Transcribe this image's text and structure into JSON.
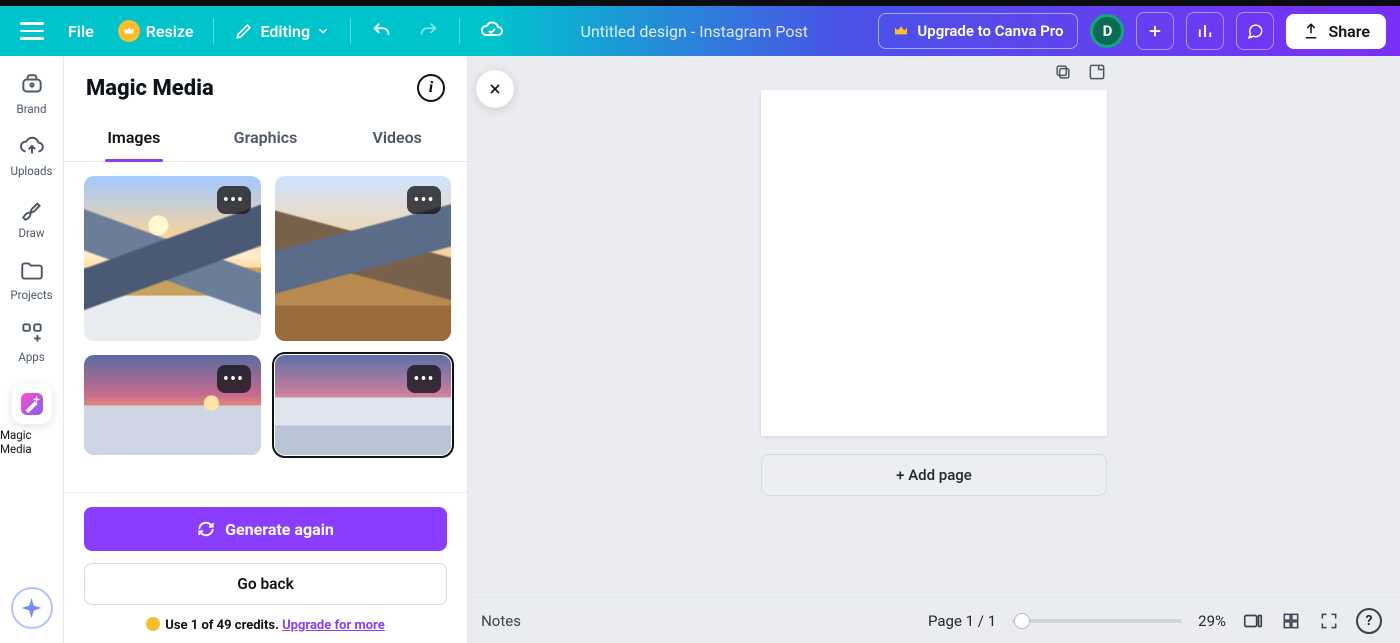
{
  "topbar": {
    "file": "File",
    "resize": "Resize",
    "editing": "Editing",
    "title": "Untitled design - Instagram Post",
    "upgrade": "Upgrade to Canva Pro",
    "avatar_initial": "D",
    "share": "Share"
  },
  "rail": {
    "brand": "Brand",
    "uploads": "Uploads",
    "draw": "Draw",
    "projects": "Projects",
    "apps": "Apps",
    "magic_media": "Magic Media"
  },
  "panel": {
    "title": "Magic Media",
    "tabs": {
      "images": "Images",
      "graphics": "Graphics",
      "videos": "Videos"
    },
    "generate": "Generate again",
    "go_back": "Go back",
    "credits_prefix": "Use 1 of 49 credits. ",
    "credits_link": "Upgrade for more"
  },
  "canvas": {
    "add_page": "+ Add page"
  },
  "bottombar": {
    "notes": "Notes",
    "page_label": "Page 1 / 1",
    "zoom": "29%"
  }
}
